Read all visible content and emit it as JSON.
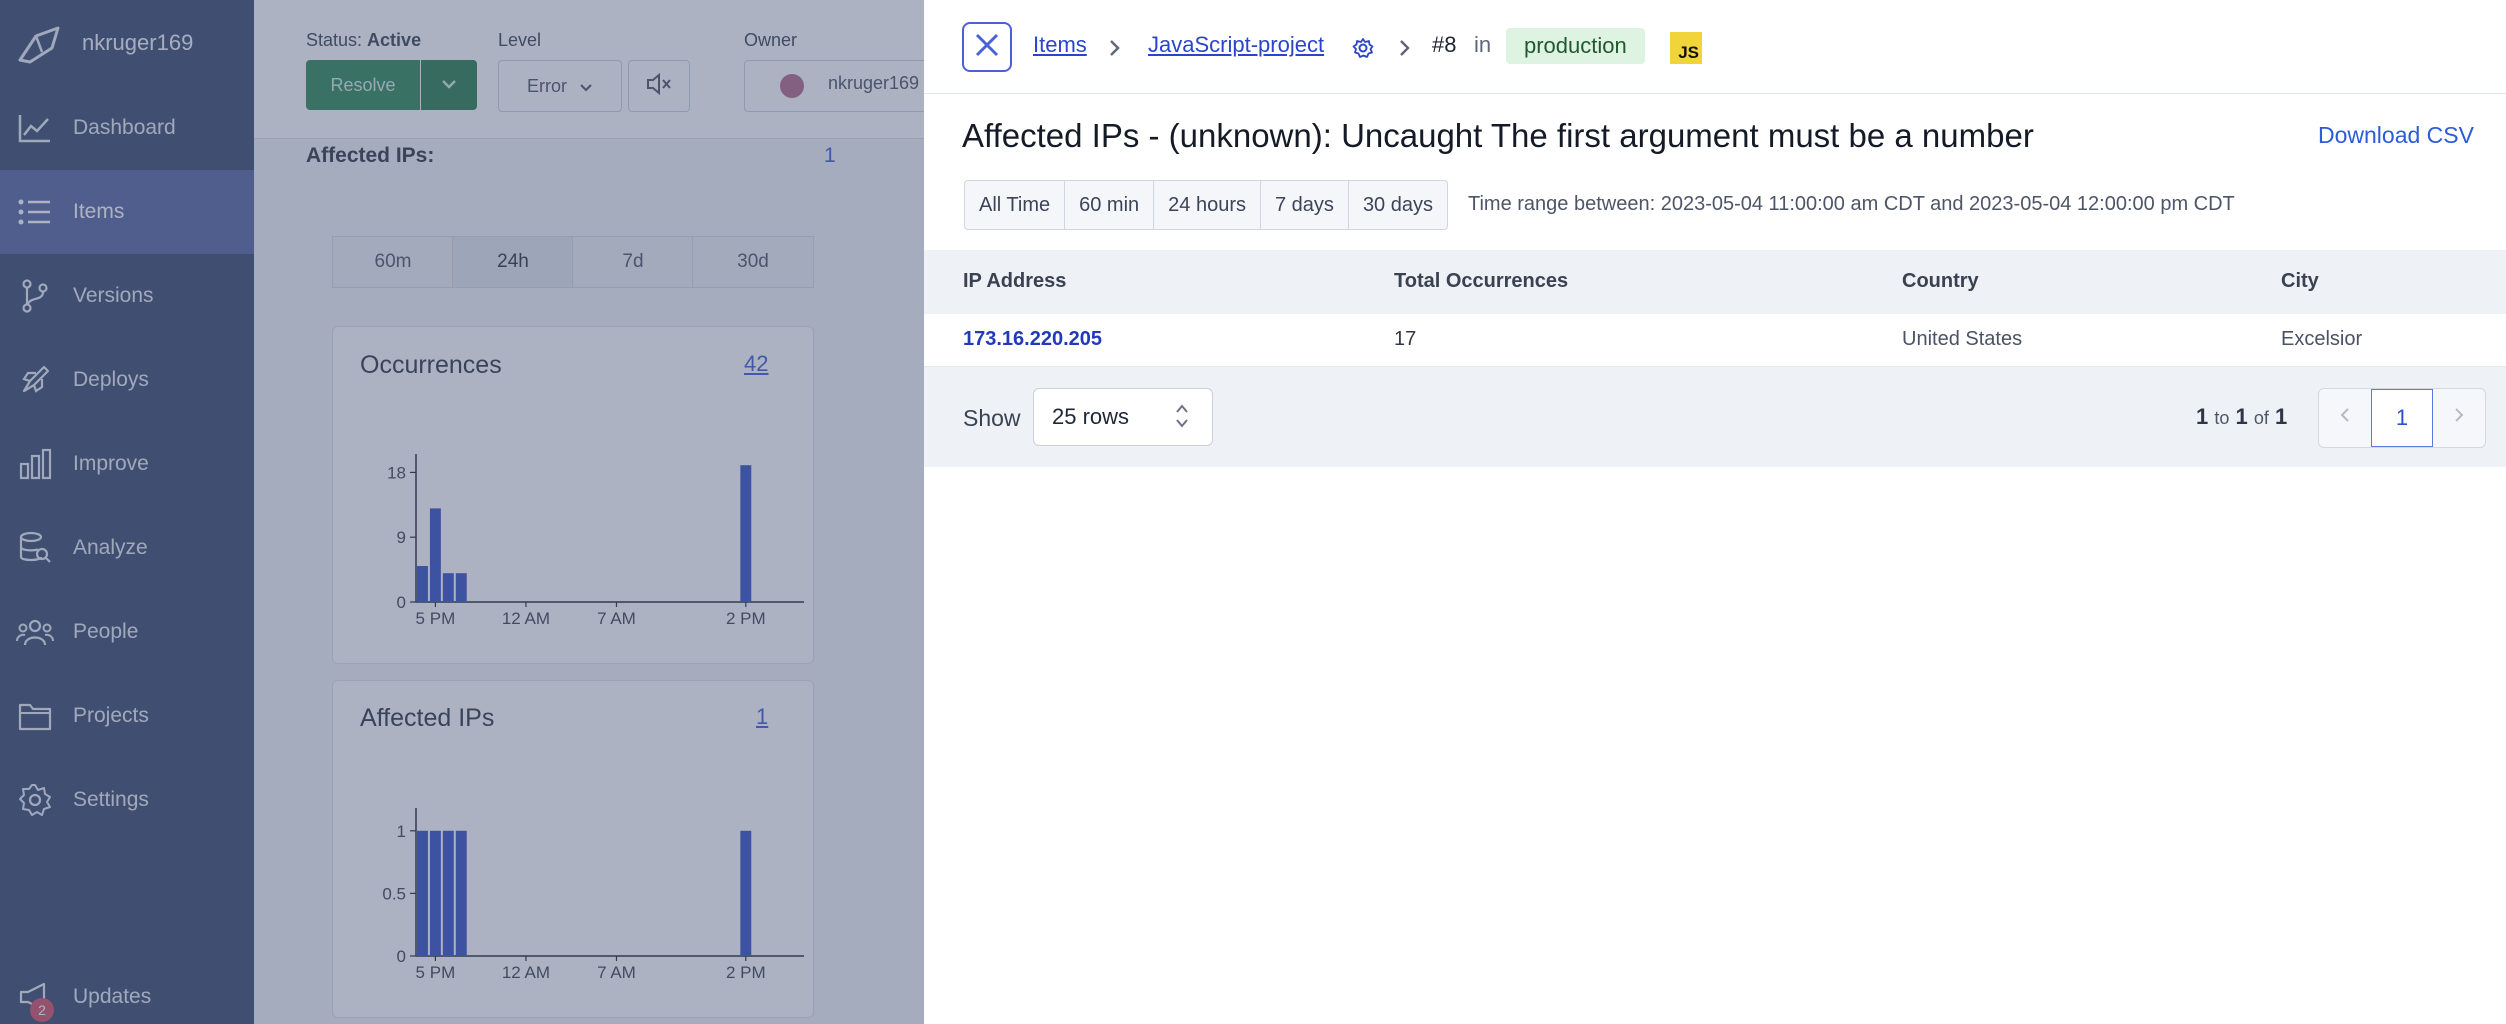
{
  "sidebar": {
    "username": "nkruger169",
    "items": [
      {
        "label": "Dashboard",
        "icon": "chart-line-icon"
      },
      {
        "label": "Items",
        "icon": "list-icon"
      },
      {
        "label": "Versions",
        "icon": "git-branch-icon"
      },
      {
        "label": "Deploys",
        "icon": "rocket-icon"
      },
      {
        "label": "Improve",
        "icon": "bar-chart-icon"
      },
      {
        "label": "Analyze",
        "icon": "database-search-icon"
      },
      {
        "label": "People",
        "icon": "users-icon"
      },
      {
        "label": "Projects",
        "icon": "folder-icon"
      },
      {
        "label": "Settings",
        "icon": "gear-icon"
      }
    ],
    "updates": {
      "label": "Updates",
      "count": "2"
    }
  },
  "middle": {
    "status_label": "Status:",
    "status_value": "Active",
    "level_label": "Level",
    "owner_label": "Owner",
    "resolve_label": "Resolve",
    "level_value": "Error",
    "owner_value": "nkruger169",
    "affected_ips_label": "Affected IPs:",
    "affected_ips_value": "1",
    "range_tabs": [
      "60m",
      "24h",
      "7d",
      "30d"
    ],
    "occurrences": {
      "title": "Occurrences",
      "count": "42"
    },
    "affected_ips_card": {
      "title": "Affected IPs",
      "count": "1"
    }
  },
  "chart_data": [
    {
      "type": "bar",
      "title": "Occurrences",
      "x_tick_labels": [
        "5 PM",
        "12 AM",
        "7 AM",
        "2 PM"
      ],
      "y_ticks": [
        "0",
        "9",
        "18"
      ],
      "ylim": [
        0,
        20
      ],
      "values": [
        5,
        13,
        4,
        4,
        0,
        0,
        0,
        0,
        0,
        0,
        0,
        0,
        0,
        0,
        0,
        0,
        0,
        0,
        0,
        0,
        0,
        0,
        0,
        0,
        0,
        19,
        0,
        0,
        0,
        0
      ]
    },
    {
      "type": "bar",
      "title": "Affected IPs",
      "x_tick_labels": [
        "5 PM",
        "12 AM",
        "7 AM",
        "2 PM"
      ],
      "y_ticks": [
        "0",
        "0.5",
        "1"
      ],
      "ylim": [
        0,
        1.15
      ],
      "values": [
        1,
        1,
        1,
        1,
        0,
        0,
        0,
        0,
        0,
        0,
        0,
        0,
        0,
        0,
        0,
        0,
        0,
        0,
        0,
        0,
        0,
        0,
        0,
        0,
        0,
        1,
        0,
        0,
        0,
        0
      ]
    }
  ],
  "panel": {
    "breadcrumb": {
      "items_label": "Items",
      "project_label": "JavaScript-project",
      "item_number": "#8",
      "in_label": "in",
      "environment": "production",
      "language_badge": "JS"
    },
    "title": "Affected IPs - (unknown): Uncaught The first argument must be a number",
    "download_csv_label": "Download CSV",
    "time_ranges": [
      "All Time",
      "60 min",
      "24 hours",
      "7 days",
      "30 days"
    ],
    "time_range_text": "Time range between: 2023-05-04 11:00:00 am CDT and 2023-05-04 12:00:00 pm CDT",
    "table": {
      "headers": [
        "IP Address",
        "Total Occurrences",
        "Country",
        "City"
      ],
      "rows": [
        {
          "ip": "173.16.220.205",
          "occurrences": "17",
          "country": "United States",
          "city": "Excelsior"
        }
      ]
    },
    "footer": {
      "show_label": "Show",
      "rows_value": "25 rows",
      "range_start": "1",
      "to_label": "to",
      "range_end": "1",
      "of_label": "of",
      "total": "1",
      "current_page": "1"
    }
  }
}
